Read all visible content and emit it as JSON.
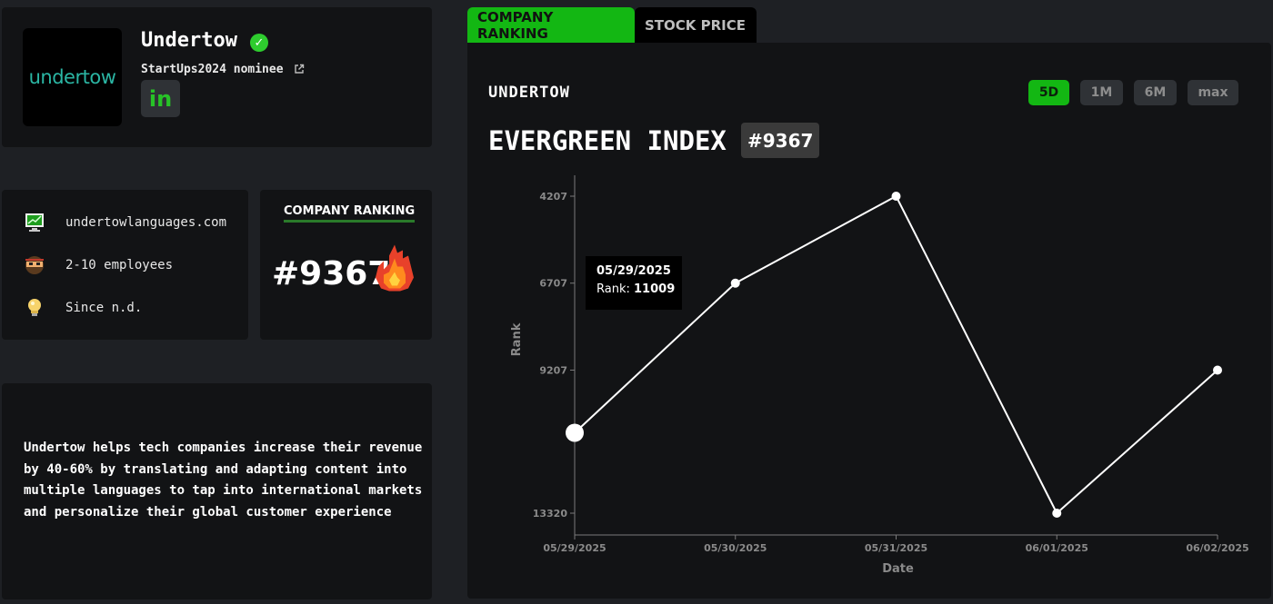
{
  "profile": {
    "logo_text": "undertow",
    "name": "Undertow",
    "nominee": "StartUps2024 nominee",
    "icons": {
      "verified": "verified-check-icon",
      "external": "external-link-icon",
      "linkedin": "linkedin-icon"
    },
    "linkedin_label": "in"
  },
  "info": {
    "website": "undertowlanguages.com",
    "employees": "2-10 employees",
    "since": "Since n.d.",
    "icons": [
      "monitor-icon",
      "ninja-icon",
      "lightbulb-icon"
    ]
  },
  "ranking_card": {
    "heading": "COMPANY RANKING",
    "value": "#9367",
    "icon": "fire-icon"
  },
  "description": "Undertow helps tech companies increase their revenue by 40-60% by translating and adapting content into multiple languages to tap into international markets and personalize their global customer experience",
  "tabs": [
    {
      "label": "COMPANY RANKING",
      "active": true
    },
    {
      "label": "STOCK PRICE",
      "active": false
    }
  ],
  "chart_panel": {
    "company": "UNDERTOW",
    "title": "EVERGREEN INDEX",
    "rank_badge": "#9367",
    "ranges": [
      {
        "label": "5D",
        "active": true
      },
      {
        "label": "1M",
        "active": false
      },
      {
        "label": "6M",
        "active": false
      },
      {
        "label": "max",
        "active": false
      }
    ],
    "tooltip": {
      "date": "05/29/2025",
      "rank_label": "Rank:",
      "rank_value": "11009"
    }
  },
  "colors": {
    "accent": "#13b713",
    "panel": "#121315",
    "background": "#1e2024"
  },
  "chart_data": {
    "type": "line",
    "x": [
      "05/29/2025",
      "05/30/2025",
      "05/31/2025",
      "06/01/2025",
      "06/02/2025"
    ],
    "series": [
      {
        "values": [
          11009,
          6707,
          4207,
          13320,
          9207
        ]
      }
    ],
    "xlabel": "Date",
    "ylabel": "Rank",
    "yticks": [
      "4207",
      "6707",
      "9207",
      "13320"
    ],
    "y_inverted": true,
    "ylim": [
      3600,
      13320
    ],
    "grid": false
  }
}
